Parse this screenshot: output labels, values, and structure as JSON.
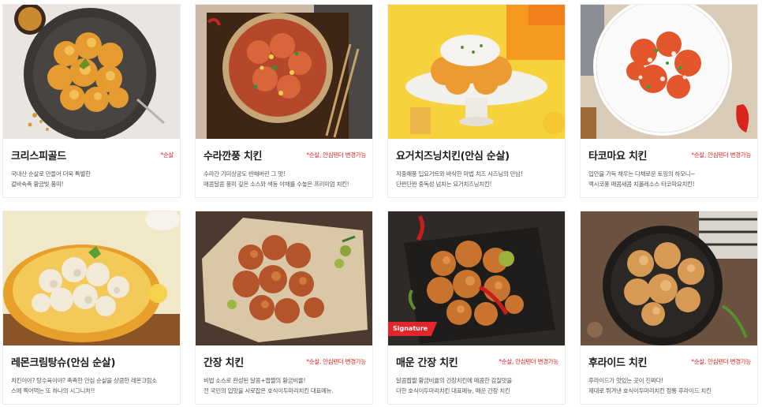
{
  "menu": [
    {
      "name": "크리스피골드",
      "option": "*순살",
      "desc": [
        "국내산 순살로 만들어 더욱 특별한",
        "겉바속촉 황금빛 풍미!"
      ]
    },
    {
      "name": "수라깐풍 치킨",
      "option": "*순살, 안심텐더 변경가능",
      "desc": [
        "수라간 기미상궁도 반해버린 그 맛!",
        "매콤달콤 풍미 깊은 소스와 색동 야채를 수놓은 프리미엄 치킨!"
      ]
    },
    {
      "name": "요거치즈닝치킨(안심 순살)",
      "option": "",
      "desc": [
        "지중해풍 딥요거트와 바삭한 마법 치즈 시즈닝의 만남!",
        "단짠단짠 중독성 넘치는 요거치즈닝치킨!"
      ]
    },
    {
      "name": "타코마요 치킨",
      "option": "*순살, 안심텐더 변경가능",
      "desc": [
        "입안을 가득 채우는 다채로운 토핑의 하모니~",
        "멕시코풍 매콤새콤 치폴레소스 타코마요치킨!"
      ]
    },
    {
      "name": "레몬크림탕슈(안심 순살)",
      "option": "",
      "desc": [
        "치킨이야? 탕수육이야? 촉촉한 안심 순살을 상큼한 레몬크림소",
        "스에 찍어먹는 또 하나의 시그니처!!"
      ]
    },
    {
      "name": "간장 치킨",
      "option": "*순살, 안심텐더 변경가능",
      "desc": [
        "비법 소스로 완성된 달콤+짭짤의 황금비율!",
        "전 국민의 입맛을 사로잡은 호식이두마리치킨 대표메뉴."
      ]
    },
    {
      "name": "매운 간장 치킨",
      "option": "*순살, 안심텐더 변경가능",
      "badge": "Signature",
      "desc": [
        "달콤짭짤 황금비율의 간장치킨에 매콤한 감칠맛을",
        "더한 호식이두마리치킨 대표메뉴, 매운 간장 치킨"
      ]
    },
    {
      "name": "후라이드 치킨",
      "option": "*순살, 안심텐더 변경가능",
      "desc": [
        "후라이드가 맛있는 곳이 진짜다!",
        "제대로 튀겨낸 호식이두마리치킨 정통 후라이드 치킨"
      ]
    }
  ]
}
